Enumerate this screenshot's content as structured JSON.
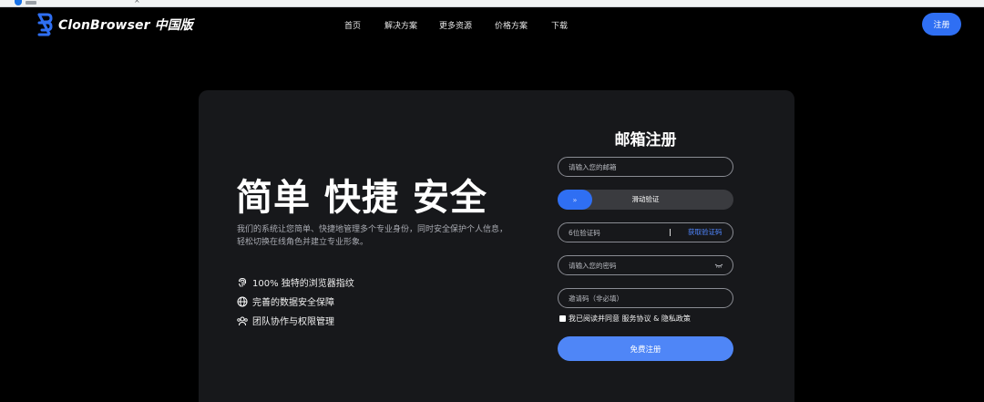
{
  "brand": {
    "name": "ClonBrowser 中国版",
    "accent": "#2f6ff3"
  },
  "nav": {
    "items": [
      {
        "label": "首页"
      },
      {
        "label": "解决方案"
      },
      {
        "label": "更多资源"
      },
      {
        "label": "价格方案"
      },
      {
        "label": "下载"
      }
    ],
    "register_label": "注册"
  },
  "hero": {
    "headline": "简单 快捷 安全",
    "description": "我们的系统让您简单、快捷地管理多个专业身份，同时安全保护个人信息，轻松切换在线角色并建立专业形象。",
    "features": [
      {
        "icon": "fingerprint-icon",
        "text": "100% 独特的浏览器指纹"
      },
      {
        "icon": "globe-icon",
        "text": "完善的数据安全保障"
      },
      {
        "icon": "team-icon",
        "text": "团队协作与权限管理"
      }
    ]
  },
  "form": {
    "title": "邮箱注册",
    "email_placeholder": "请输入您的邮箱",
    "slider_label": "滑动验证",
    "slider_handle": "»",
    "code_placeholder": "6位验证码",
    "get_code_label": "获取验证码",
    "password_placeholder": "请输入您的密码",
    "invite_placeholder": "邀请码（非必填）",
    "agree_text": "我已阅读并同意 服务协议 & 隐私政策",
    "submit_label": "免费注册"
  }
}
